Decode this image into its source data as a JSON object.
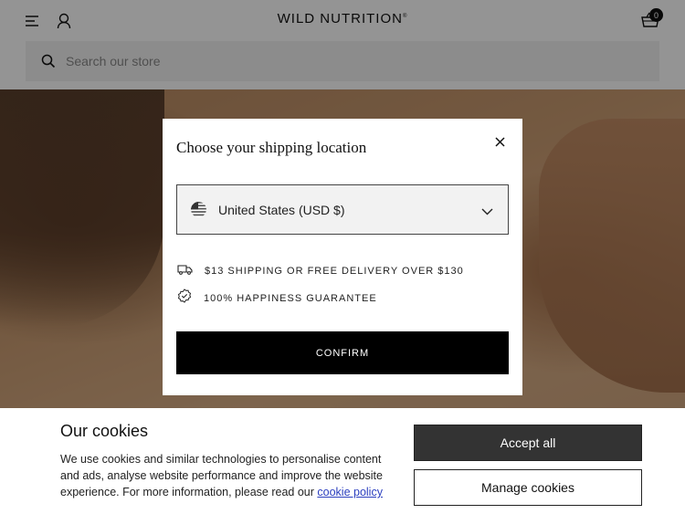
{
  "header": {
    "logo": "WILD NUTRITION",
    "logo_mark": "®",
    "cart_count": "0",
    "search": {
      "placeholder": "Search our store"
    }
  },
  "modal": {
    "title": "Choose your shipping location",
    "selected_country": "United States (USD $)",
    "perks": [
      {
        "icon": "delivery-truck-icon",
        "text": "$13 SHIPPING OR FREE DELIVERY OVER $130"
      },
      {
        "icon": "badge-check-icon",
        "text": "100% HAPPINESS GUARANTEE"
      }
    ],
    "confirm_label": "CONFIRM"
  },
  "cookies": {
    "title": "Our cookies",
    "body": "We use cookies and similar technologies to personalise content and ads, analyse website performance and improve the website experience. For more information, please read our ",
    "link_label": "cookie policy",
    "accept_label": "Accept all",
    "manage_label": "Manage cookies"
  },
  "colors": {
    "overlay": "#000000",
    "accept_bg": "#333333",
    "link": "#2b3fbf"
  }
}
